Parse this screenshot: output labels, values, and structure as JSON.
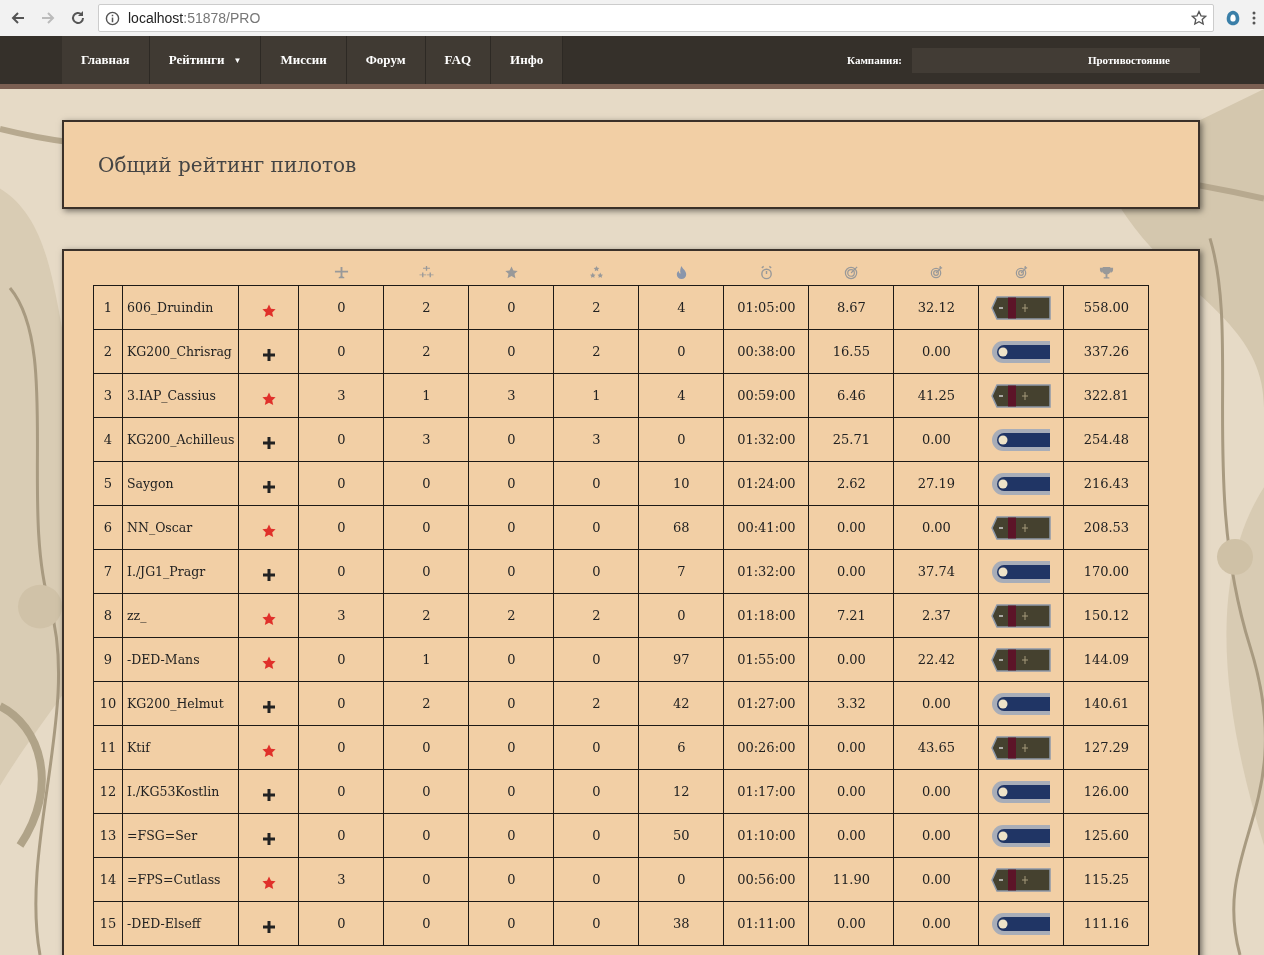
{
  "browser": {
    "url_host": "localhost",
    "url_path": ":51878/PRO"
  },
  "nav": {
    "items": [
      {
        "label": "Главная",
        "dropdown": false
      },
      {
        "label": "Рейтинги",
        "dropdown": true,
        "caret": "▼"
      },
      {
        "label": "Миссии",
        "dropdown": false
      },
      {
        "label": "Форум",
        "dropdown": false
      },
      {
        "label": "FAQ",
        "dropdown": false
      },
      {
        "label": "Инфо",
        "dropdown": false
      }
    ],
    "campaign_label": "Кампания:",
    "campaign_value": "Противостояние"
  },
  "page_title": "Общий рейтинг пилотов",
  "table": {
    "rows": [
      {
        "rank": "1",
        "name": "606_Druindin",
        "kind": "soviet",
        "values": [
          "0",
          "2",
          "0",
          "2",
          "4",
          "01:05:00",
          "8.67",
          "32.12"
        ],
        "score": "558.00"
      },
      {
        "rank": "2",
        "name": "KG200_Chrisrag",
        "kind": "german",
        "values": [
          "0",
          "2",
          "0",
          "2",
          "0",
          "00:38:00",
          "16.55",
          "0.00"
        ],
        "score": "337.26"
      },
      {
        "rank": "3",
        "name": "3.IAP_Cassius",
        "kind": "soviet",
        "values": [
          "3",
          "1",
          "3",
          "1",
          "4",
          "00:59:00",
          "6.46",
          "41.25"
        ],
        "score": "322.81"
      },
      {
        "rank": "4",
        "name": "KG200_Achilleus",
        "kind": "german",
        "values": [
          "0",
          "3",
          "0",
          "3",
          "0",
          "01:32:00",
          "25.71",
          "0.00"
        ],
        "score": "254.48"
      },
      {
        "rank": "5",
        "name": "Saygon",
        "kind": "german",
        "values": [
          "0",
          "0",
          "0",
          "0",
          "10",
          "01:24:00",
          "2.62",
          "27.19"
        ],
        "score": "216.43"
      },
      {
        "rank": "6",
        "name": "NN_Oscar",
        "kind": "soviet",
        "values": [
          "0",
          "0",
          "0",
          "0",
          "68",
          "00:41:00",
          "0.00",
          "0.00"
        ],
        "score": "208.53"
      },
      {
        "rank": "7",
        "name": "I./JG1_Pragr",
        "kind": "german",
        "values": [
          "0",
          "0",
          "0",
          "0",
          "7",
          "01:32:00",
          "0.00",
          "37.74"
        ],
        "score": "170.00"
      },
      {
        "rank": "8",
        "name": "zz_",
        "kind": "soviet",
        "values": [
          "3",
          "2",
          "2",
          "2",
          "0",
          "01:18:00",
          "7.21",
          "2.37"
        ],
        "score": "150.12"
      },
      {
        "rank": "9",
        "name": "-DED-Mans",
        "kind": "soviet",
        "values": [
          "0",
          "1",
          "0",
          "0",
          "97",
          "01:55:00",
          "0.00",
          "22.42"
        ],
        "score": "144.09"
      },
      {
        "rank": "10",
        "name": "KG200_Helmut",
        "kind": "german",
        "values": [
          "0",
          "2",
          "0",
          "2",
          "42",
          "01:27:00",
          "3.32",
          "0.00"
        ],
        "score": "140.61"
      },
      {
        "rank": "11",
        "name": "Ktif",
        "kind": "soviet",
        "values": [
          "0",
          "0",
          "0",
          "0",
          "6",
          "00:26:00",
          "0.00",
          "43.65"
        ],
        "score": "127.29"
      },
      {
        "rank": "12",
        "name": "I./KG53Kostlin",
        "kind": "german",
        "values": [
          "0",
          "0",
          "0",
          "0",
          "12",
          "01:17:00",
          "0.00",
          "0.00"
        ],
        "score": "126.00"
      },
      {
        "rank": "13",
        "name": "=FSG=Ser",
        "kind": "german",
        "values": [
          "0",
          "0",
          "0",
          "0",
          "50",
          "01:10:00",
          "0.00",
          "0.00"
        ],
        "score": "125.60"
      },
      {
        "rank": "14",
        "name": "=FPS=Cutlass",
        "kind": "soviet",
        "values": [
          "3",
          "0",
          "0",
          "0",
          "0",
          "00:56:00",
          "11.90",
          "0.00"
        ],
        "score": "115.25"
      },
      {
        "rank": "15",
        "name": "-DED-Elseff",
        "kind": "german",
        "values": [
          "0",
          "0",
          "0",
          "0",
          "38",
          "01:11:00",
          "0.00",
          "0.00"
        ],
        "score": "111.16"
      }
    ]
  }
}
